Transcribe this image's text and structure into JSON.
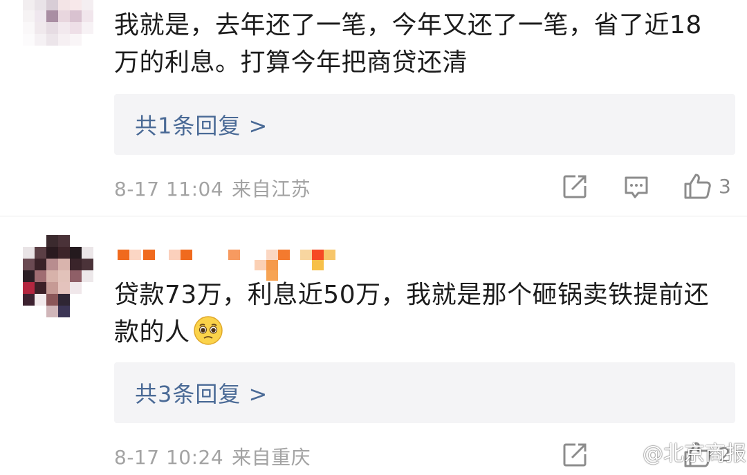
{
  "comments": [
    {
      "text": "我就是，去年还了一笔，今年又还了一笔，省了近18万的利息。打算今年把商贷还清",
      "reply_link": "共1条回复 >",
      "time": "8-17 11:04",
      "region": "来自江苏",
      "like_count": "3"
    },
    {
      "text": "贷款73万，利息近50万，我就是那个砸锅卖铁提前还款的人",
      "reply_link": "共3条回复 >",
      "time": "8-17 10:24",
      "region": "来自重庆",
      "like_count": "2"
    }
  ],
  "icons": {
    "share": "share-icon",
    "comment": "comment-icon",
    "like": "thumbs-up-icon",
    "emoji": "pleading-face-emoji"
  },
  "watermark": {
    "text": "@北京商报"
  },
  "colors": {
    "reply_link": "#4a6a96",
    "reply_bg": "#f4f4f6",
    "meta": "#a3a3a3"
  }
}
